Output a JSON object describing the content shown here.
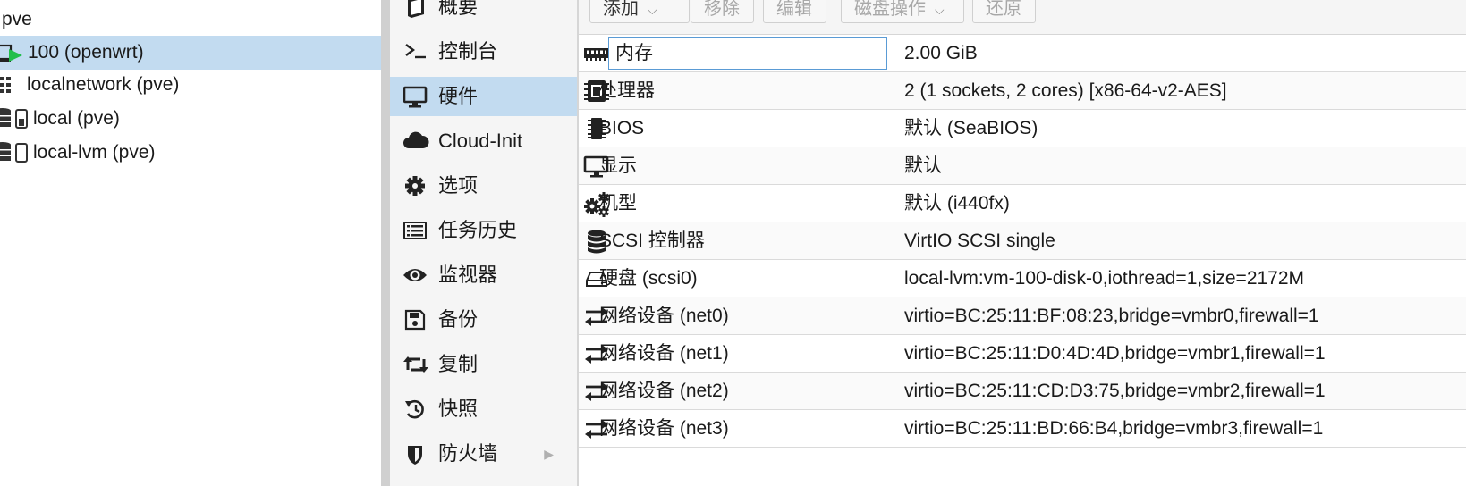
{
  "tree": {
    "root_label": "pve",
    "items": [
      {
        "label": "100 (openwrt)",
        "icon": "vm-running-icon",
        "selected": true
      },
      {
        "label": "localnetwork (pve)",
        "icon": "network-grid-icon",
        "selected": false
      },
      {
        "label": "local (pve)",
        "icon": "storage-icon",
        "selected": false
      },
      {
        "label": "local-lvm (pve)",
        "icon": "storage-icon",
        "selected": false
      }
    ]
  },
  "nav": {
    "items": [
      {
        "label": "概要",
        "icon": "book-icon"
      },
      {
        "label": "控制台",
        "icon": "terminal-icon"
      },
      {
        "label": "硬件",
        "icon": "desktop-icon",
        "selected": true
      },
      {
        "label": "Cloud-Init",
        "icon": "cloud-icon"
      },
      {
        "label": "选项",
        "icon": "gear-icon"
      },
      {
        "label": "任务历史",
        "icon": "list-icon"
      },
      {
        "label": "监视器",
        "icon": "eye-icon"
      },
      {
        "label": "备份",
        "icon": "floppy-icon"
      },
      {
        "label": "复制",
        "icon": "retweet-icon"
      },
      {
        "label": "快照",
        "icon": "history-icon"
      },
      {
        "label": "防火墙",
        "icon": "shield-icon",
        "has_submenu": true
      }
    ]
  },
  "toolbar": {
    "add_label": "添加",
    "remove_label": "移除",
    "edit_label": "编辑",
    "disk_action_label": "磁盘操作",
    "revert_label": "还原"
  },
  "hardware": {
    "rows": [
      {
        "key": "内存",
        "value": "2.00 GiB",
        "icon": "memory-icon"
      },
      {
        "key": "处理器",
        "value": "2 (1 sockets, 2 cores) [x86-64-v2-AES]",
        "icon": "cpu-icon"
      },
      {
        "key": "BIOS",
        "value": "默认 (SeaBIOS)",
        "icon": "microchip-icon"
      },
      {
        "key": "显示",
        "value": "默认",
        "icon": "desktop-icon"
      },
      {
        "key": "机型",
        "value": "默认 (i440fx)",
        "icon": "cogs-icon"
      },
      {
        "key": "SCSI 控制器",
        "value": "VirtIO SCSI single",
        "icon": "database-icon"
      },
      {
        "key": "硬盘 (scsi0)",
        "value": "local-lvm:vm-100-disk-0,iothread=1,size=2172M",
        "icon": "hdd-icon"
      },
      {
        "key": "网络设备 (net0)",
        "value": "virtio=BC:25:11:BF:08:23,bridge=vmbr0,firewall=1",
        "icon": "exchange-icon"
      },
      {
        "key": "网络设备 (net1)",
        "value": "virtio=BC:25:11:D0:4D:4D,bridge=vmbr1,firewall=1",
        "icon": "exchange-icon"
      },
      {
        "key": "网络设备 (net2)",
        "value": "virtio=BC:25:11:CD:D3:75,bridge=vmbr2,firewall=1",
        "icon": "exchange-icon"
      },
      {
        "key": "网络设备 (net3)",
        "value": "virtio=BC:25:11:BD:66:B4,bridge=vmbr3,firewall=1",
        "icon": "exchange-icon"
      }
    ]
  },
  "colors": {
    "selection": "#c2dbf0",
    "running_green": "#21bf4b",
    "edit_border": "#5a9bd5"
  }
}
